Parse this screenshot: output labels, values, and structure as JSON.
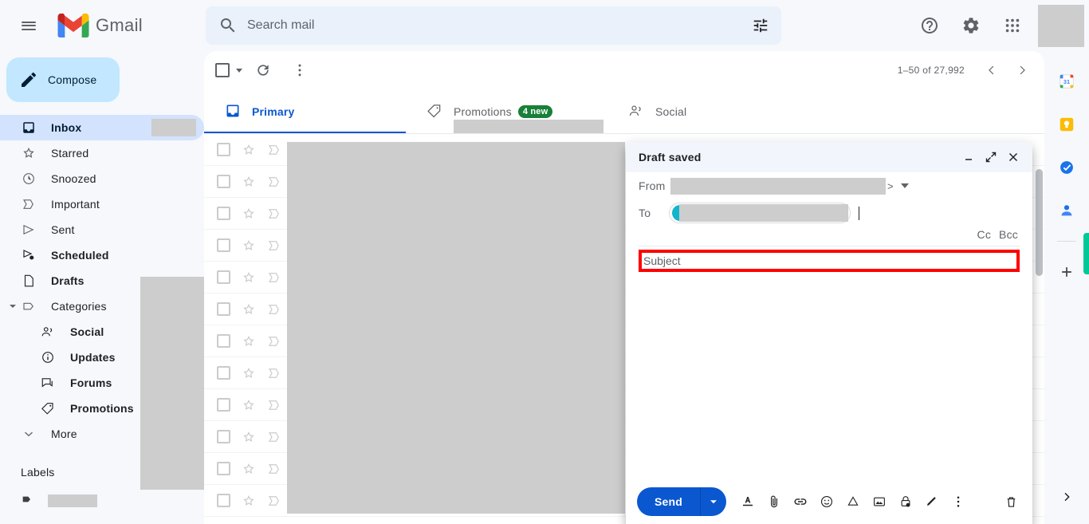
{
  "app": {
    "brand": "Gmail"
  },
  "header": {
    "menu_icon": "hamburger-menu-icon",
    "search": {
      "placeholder": "Search mail",
      "value": "",
      "icon": "search-icon",
      "filter_icon": "tune-filter-icon"
    },
    "help_icon": "help-circle-icon",
    "settings_icon": "gear-icon",
    "apps_icon": "apps-grid-icon",
    "avatar": "account-avatar"
  },
  "sidebar": {
    "compose_label": "Compose",
    "compose_icon": "pencil-icon",
    "items": [
      {
        "label": "Inbox",
        "icon": "inbox-icon",
        "active": true,
        "bold": true,
        "masked_count": true
      },
      {
        "label": "Starred",
        "icon": "star-icon",
        "active": false,
        "bold": false
      },
      {
        "label": "Snoozed",
        "icon": "clock-icon",
        "active": false,
        "bold": false
      },
      {
        "label": "Important",
        "icon": "important-marker-icon",
        "active": false,
        "bold": false
      },
      {
        "label": "Sent",
        "icon": "send-paperplane-icon",
        "active": false,
        "bold": false
      },
      {
        "label": "Scheduled",
        "icon": "scheduled-send-icon",
        "active": false,
        "bold": true
      },
      {
        "label": "Drafts",
        "icon": "draft-document-icon",
        "active": false,
        "bold": true
      },
      {
        "label": "Categories",
        "icon": "label-tag-icon",
        "active": false,
        "bold": false,
        "expanded": true
      }
    ],
    "categories": [
      {
        "label": "Social",
        "icon": "people-icon"
      },
      {
        "label": "Updates",
        "icon": "info-circle-icon"
      },
      {
        "label": "Forums",
        "icon": "forums-chat-icon"
      },
      {
        "label": "Promotions",
        "icon": "tag-icon"
      }
    ],
    "more": {
      "label": "More",
      "icon": "chevron-down-icon"
    },
    "labels": {
      "title": "Labels",
      "add_icon": "plus-icon",
      "item_icon": "label-filled-icon"
    }
  },
  "list": {
    "select_all_icon": "checkbox-icon",
    "select_dropdown_icon": "chevron-down-icon",
    "refresh_icon": "refresh-icon",
    "more_icon": "more-vertical-icon",
    "pagination": "1–50 of 27,992",
    "prev_icon": "chevron-left-icon",
    "next_icon": "chevron-right-icon",
    "tabs": [
      {
        "label": "Primary",
        "icon": "inbox-tab-icon",
        "active": true,
        "badge": ""
      },
      {
        "label": "Promotions",
        "icon": "tag-tab-icon",
        "active": false,
        "badge": "4 new"
      },
      {
        "label": "Social",
        "icon": "people-tab-icon",
        "active": false,
        "badge": ""
      }
    ],
    "row_count": 12,
    "row_icons": {
      "checkbox": "checkbox-icon",
      "star": "star-outline-icon",
      "important": "important-marker-icon"
    }
  },
  "compose": {
    "title": "Draft saved",
    "minimize_icon": "minimize-icon",
    "popout_icon": "popout-fullscreen-icon",
    "close_icon": "close-x-icon",
    "from_label": "From",
    "from_suffix": ">",
    "from_dropdown_icon": "chevron-down-icon",
    "to_label": "To",
    "cc_label": "Cc",
    "bcc_label": "Bcc",
    "subject_placeholder": "Subject",
    "subject_value": "",
    "body_value": "",
    "highlight_color": "#ff0000",
    "send_label": "Send",
    "send_options_icon": "chevron-down-icon",
    "tools": [
      {
        "name": "formatting-options-icon"
      },
      {
        "name": "attach-file-icon"
      },
      {
        "name": "insert-link-icon"
      },
      {
        "name": "insert-emoji-icon"
      },
      {
        "name": "insert-drive-file-icon"
      },
      {
        "name": "insert-photo-icon"
      },
      {
        "name": "confidential-mode-icon"
      },
      {
        "name": "insert-signature-icon"
      },
      {
        "name": "more-options-icon"
      }
    ],
    "discard_icon": "trash-icon"
  },
  "rail": {
    "items": [
      {
        "name": "google-calendar-icon"
      },
      {
        "name": "google-keep-icon"
      },
      {
        "name": "google-tasks-icon"
      },
      {
        "name": "google-contacts-icon"
      }
    ],
    "add_icon": "plus-icon",
    "expand_icon": "chevron-right-icon",
    "accent_green": "#00c998"
  }
}
